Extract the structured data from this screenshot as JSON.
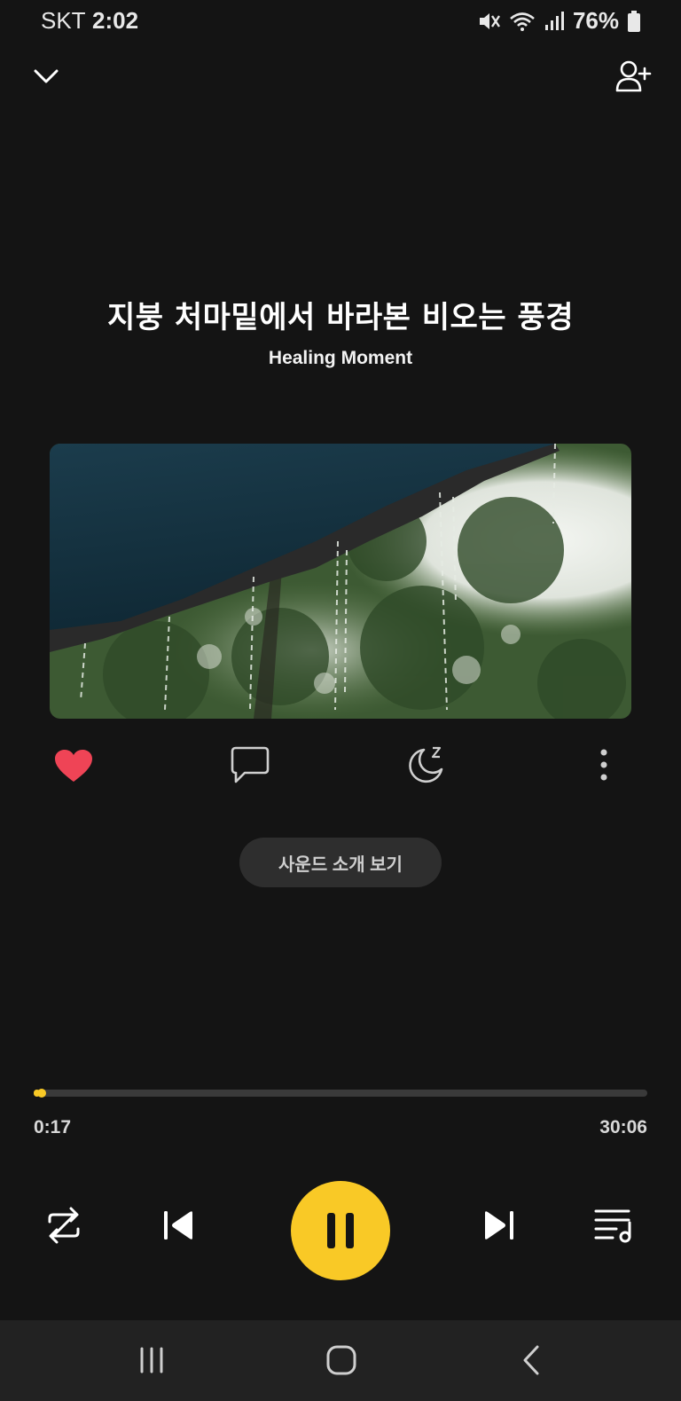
{
  "status_bar": {
    "carrier": "SKT",
    "time": "2:02",
    "battery": "76%",
    "icons": [
      "mute-icon",
      "wifi-icon",
      "signal-icon",
      "battery-icon"
    ]
  },
  "header": {
    "collapse_icon": "chevron-down-icon",
    "add_user_icon": "add-user-icon"
  },
  "track": {
    "title": "지붕 처마밑에서 바라본 비오는 풍경",
    "artist": "Healing Moment"
  },
  "actions": {
    "icons": [
      "heart-icon",
      "comment-icon",
      "sleep-timer-icon",
      "more-icon"
    ],
    "liked": true,
    "intro_button": "사운드 소개 보기"
  },
  "progress": {
    "current": "0:17",
    "total": "30:06",
    "fraction": 0.0094
  },
  "controls": {
    "icons": [
      "repeat-icon",
      "previous-icon",
      "pause-icon",
      "next-icon",
      "playlist-icon"
    ]
  },
  "navbar": {
    "icons": [
      "recent-apps-icon",
      "home-icon",
      "back-icon"
    ]
  },
  "colors": {
    "background": "#141414",
    "accent": "#f9c926",
    "heart": "#ef4456",
    "navbar": "#222222"
  }
}
